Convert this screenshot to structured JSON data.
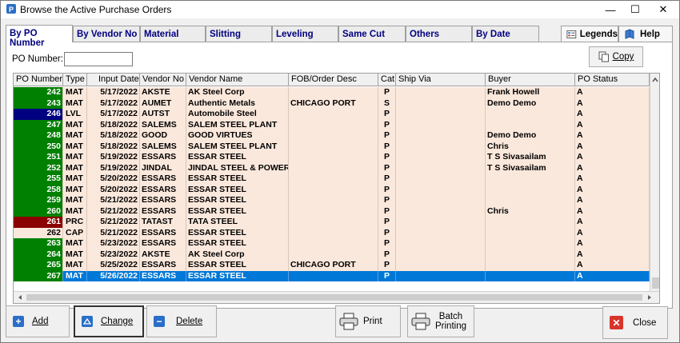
{
  "window": {
    "title": "Browse the Active Purchase Orders",
    "minimize_glyph": "—",
    "maximize_glyph": "☐",
    "close_glyph": "✕"
  },
  "tabs": [
    {
      "label": "By PO Number",
      "active": true
    },
    {
      "label": "By Vendor No",
      "active": false
    },
    {
      "label": "Material",
      "active": false
    },
    {
      "label": "Slitting",
      "active": false
    },
    {
      "label": "Leveling",
      "active": false
    },
    {
      "label": "Same Cut",
      "active": false
    },
    {
      "label": "Others",
      "active": false
    },
    {
      "label": "By Date",
      "active": false
    }
  ],
  "right_tabs": {
    "legends": "Legends",
    "help": "Help"
  },
  "filter": {
    "po_label": "PO Number:",
    "po_value": ""
  },
  "copy_button": "Copy",
  "grid": {
    "columns": [
      "PO Number",
      "Type",
      "Input Date",
      "Vendor No",
      "Vendor Name",
      "FOB/Order Desc",
      "Cat",
      "Ship Via",
      "Buyer",
      "PO Status"
    ],
    "rows": [
      {
        "po": "242",
        "type": "MAT",
        "date": "5/17/2022",
        "vendor_no": "AKSTE",
        "vendor_name": "AK Steel Corp",
        "fob": "",
        "cat": "P",
        "ship": "",
        "buyer": "Frank Howell",
        "status": "A",
        "po_color": "#008000"
      },
      {
        "po": "243",
        "type": "MAT",
        "date": "5/17/2022",
        "vendor_no": "AUMET",
        "vendor_name": "Authentic Metals",
        "fob": "CHICAGO PORT",
        "cat": "S",
        "ship": "",
        "buyer": "Demo Demo",
        "status": "A",
        "po_color": "#008000"
      },
      {
        "po": "246",
        "type": "LVL",
        "date": "5/17/2022",
        "vendor_no": "AUTST",
        "vendor_name": "Automobile Steel",
        "fob": "",
        "cat": "P",
        "ship": "",
        "buyer": "",
        "status": "A",
        "po_color": "#000080"
      },
      {
        "po": "247",
        "type": "MAT",
        "date": "5/18/2022",
        "vendor_no": "SALEMS",
        "vendor_name": "SALEM STEEL PLANT",
        "fob": "",
        "cat": "P",
        "ship": "",
        "buyer": "",
        "status": "A",
        "po_color": "#008000"
      },
      {
        "po": "248",
        "type": "MAT",
        "date": "5/18/2022",
        "vendor_no": "GOOD",
        "vendor_name": "GOOD VIRTUES",
        "fob": "",
        "cat": "P",
        "ship": "",
        "buyer": "Demo Demo",
        "status": "A",
        "po_color": "#008000"
      },
      {
        "po": "250",
        "type": "MAT",
        "date": "5/18/2022",
        "vendor_no": "SALEMS",
        "vendor_name": "SALEM STEEL PLANT",
        "fob": "",
        "cat": "P",
        "ship": "",
        "buyer": "Chris",
        "status": "A",
        "po_color": "#008000"
      },
      {
        "po": "251",
        "type": "MAT",
        "date": "5/19/2022",
        "vendor_no": "ESSARS",
        "vendor_name": " ESSAR STEEL",
        "fob": "",
        "cat": "P",
        "ship": "",
        "buyer": "T S Sivasailam",
        "status": "A",
        "po_color": "#008000"
      },
      {
        "po": "252",
        "type": "MAT",
        "date": "5/19/2022",
        "vendor_no": "JINDAL",
        "vendor_name": "JINDAL STEEL & POWER",
        "fob": "",
        "cat": "P",
        "ship": "",
        "buyer": "T S Sivasailam",
        "status": "A",
        "po_color": "#008000"
      },
      {
        "po": "255",
        "type": "MAT",
        "date": "5/20/2022",
        "vendor_no": "ESSARS",
        "vendor_name": " ESSAR STEEL",
        "fob": "",
        "cat": "P",
        "ship": "",
        "buyer": "",
        "status": "A",
        "po_color": "#008000"
      },
      {
        "po": "258",
        "type": "MAT",
        "date": "5/20/2022",
        "vendor_no": "ESSARS",
        "vendor_name": " ESSAR STEEL",
        "fob": "",
        "cat": "P",
        "ship": "",
        "buyer": "",
        "status": "A",
        "po_color": "#008000"
      },
      {
        "po": "259",
        "type": "MAT",
        "date": "5/21/2022",
        "vendor_no": "ESSARS",
        "vendor_name": " ESSAR STEEL",
        "fob": "",
        "cat": "P",
        "ship": "",
        "buyer": "",
        "status": "A",
        "po_color": "#008000"
      },
      {
        "po": "260",
        "type": "MAT",
        "date": "5/21/2022",
        "vendor_no": "ESSARS",
        "vendor_name": " ESSAR STEEL",
        "fob": "",
        "cat": "P",
        "ship": "",
        "buyer": "Chris",
        "status": "A",
        "po_color": "#008000"
      },
      {
        "po": "261",
        "type": "PRC",
        "date": "5/21/2022",
        "vendor_no": "TATAST",
        "vendor_name": "TATA STEEL",
        "fob": "",
        "cat": "P",
        "ship": "",
        "buyer": "",
        "status": "A",
        "po_color": "#8b0000"
      },
      {
        "po": "262",
        "type": "CAP",
        "date": "5/21/2022",
        "vendor_no": "ESSARS",
        "vendor_name": " ESSAR STEEL",
        "fob": "",
        "cat": "P",
        "ship": "",
        "buyer": "",
        "status": "A",
        "po_color": "#fbe8dc"
      },
      {
        "po": "263",
        "type": "MAT",
        "date": "5/23/2022",
        "vendor_no": "ESSARS",
        "vendor_name": " ESSAR STEEL",
        "fob": "",
        "cat": "P",
        "ship": "",
        "buyer": "",
        "status": "A",
        "po_color": "#008000"
      },
      {
        "po": "264",
        "type": "MAT",
        "date": "5/23/2022",
        "vendor_no": "AKSTE",
        "vendor_name": "AK Steel Corp",
        "fob": "",
        "cat": "P",
        "ship": "",
        "buyer": "",
        "status": "A",
        "po_color": "#008000"
      },
      {
        "po": "265",
        "type": "MAT",
        "date": "5/25/2022",
        "vendor_no": "ESSARS",
        "vendor_name": " ESSAR STEEL",
        "fob": "CHICAGO PORT",
        "cat": "P",
        "ship": "",
        "buyer": "",
        "status": "A",
        "po_color": "#008000"
      },
      {
        "po": "267",
        "type": "MAT",
        "date": "5/26/2022",
        "vendor_no": "ESSARS",
        "vendor_name": " ESSAR STEEL",
        "fob": "",
        "cat": "P",
        "ship": "",
        "buyer": "",
        "status": "A",
        "po_color": "#008000",
        "selected": true
      }
    ]
  },
  "colors": {
    "row_bg": "#fbe8dc",
    "selected_bg": "#0078d7",
    "po_green": "#008000",
    "po_blue": "#000080",
    "po_maroon": "#8b0000"
  },
  "buttons": {
    "add": "Add",
    "change": "Change",
    "delete": "Delete",
    "print": "Print",
    "batch_line1": "Batch",
    "batch_line2": "Printing",
    "close": "Close"
  }
}
